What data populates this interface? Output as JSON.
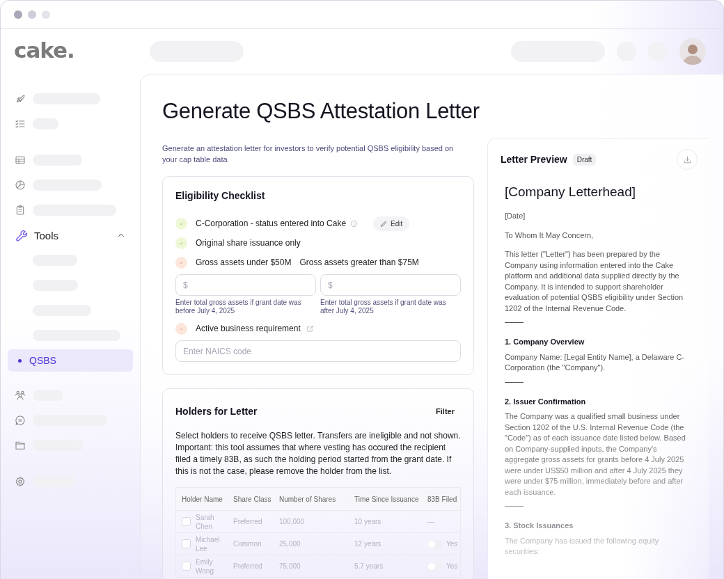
{
  "logo": "cake.",
  "sidebar": {
    "sections": [
      {
        "items": [
          {
            "kind": "skeleton"
          },
          {
            "kind": "skeleton"
          }
        ]
      },
      {
        "items": [
          {
            "kind": "skeleton"
          },
          {
            "kind": "skeleton"
          },
          {
            "kind": "skeleton"
          },
          {
            "kind": "group",
            "label": "Tools",
            "expanded": true,
            "children": [
              {
                "kind": "skeleton",
                "selected": false
              },
              {
                "kind": "skeleton",
                "selected": false
              },
              {
                "kind": "skeleton",
                "selected": false
              },
              {
                "kind": "skeleton",
                "selected": false
              },
              {
                "kind": "link",
                "label": "QSBS",
                "selected": true
              }
            ]
          }
        ]
      },
      {
        "items": [
          {
            "kind": "skeleton"
          },
          {
            "kind": "skeleton"
          },
          {
            "kind": "skeleton"
          }
        ]
      },
      {
        "items": [
          {
            "kind": "skeleton"
          }
        ]
      }
    ]
  },
  "page": {
    "title": "Generate QSBS Attestation Letter",
    "subtitle": "Generate an attestation letter for investors to verify potential QSBS eligibility based on your cap table data"
  },
  "eligibility": {
    "title": "Eligibility Checklist",
    "items": [
      {
        "kind": "edit",
        "met": true,
        "label": "C-Corporation - status entered into Cake",
        "action": "Edit"
      },
      {
        "kind": "plain",
        "met": true,
        "label": "Original share issuance only"
      },
      {
        "kind": "plain",
        "met": false,
        "label": "Gross assets under $50M",
        "label_2": "Gross assets greater than $75M",
        "fields": [
          {
            "placeholder": "$",
            "hint": "Enter total gross assets if grant date was before July 4, 2025"
          },
          {
            "placeholder": "$",
            "hint": "Enter total gross assets if grant date was after July 4, 2025"
          }
        ]
      },
      {
        "kind": "external",
        "met": false,
        "label": "Active business requirement",
        "fields": [
          {
            "placeholder": "Enter NAICS code"
          }
        ]
      }
    ]
  },
  "holders": {
    "title": "Holders for Letter",
    "filter": "Filter",
    "description": "Select holders to receive QSBS letter. Transfers are ineligible and not shown. Important: this tool assumes that where vesting has occured the recipient filed a timely 83B, as such the holding period started from the grant date. If this is not the case, please remove the holder from the list.",
    "columns": [
      "Holder Name",
      "Share Class",
      "Number of Shares",
      "Time Since Issuance",
      "83B Filed"
    ],
    "rows": [
      {
        "selected": false,
        "name": "Sarah Chen",
        "share_class": "Preferred",
        "shares": "100,000",
        "time": "10 years",
        "filed": {
          "kind": "dash",
          "text": "—"
        }
      },
      {
        "selected": false,
        "name": "Michael Lee",
        "share_class": "Common",
        "shares": "25,000",
        "time": "12 years",
        "filed": {
          "kind": "toggle",
          "on": false,
          "text": "Yes"
        }
      },
      {
        "selected": false,
        "name": "Emily Wong",
        "share_class": "Preferred",
        "shares": "75,000",
        "time": "5.7 years",
        "filed": {
          "kind": "toggle",
          "on": false,
          "text": "Yes"
        }
      }
    ]
  },
  "preview": {
    "title": "Letter Preview",
    "badge": "Draft",
    "blocks": [
      {
        "kind": "heading",
        "text": "[Company Letterhead]"
      },
      {
        "kind": "text",
        "text": "[Date]"
      },
      {
        "kind": "text",
        "text": "To Whom It May Concern,"
      },
      {
        "kind": "text",
        "text": "This letter (\"Letter\") has been prepared by the Company using information entered into the Cake platform and additional data supplied directly by the Company. It is intended to support shareholder evaluation of potential QSBS eligibility under Section 1202 of the Internal Revenue Code."
      },
      {
        "kind": "rule"
      },
      {
        "kind": "section",
        "text": "1. Company Overview"
      },
      {
        "kind": "text",
        "text": "Company Name: [Legal Entity Name], a Delaware C-Corporation (the \"Company\")."
      },
      {
        "kind": "rule"
      },
      {
        "kind": "section",
        "text": "2. Issuer Confirmation"
      },
      {
        "kind": "text",
        "text": "The Company was a qualified small business under Section 1202 of the U.S. Internal Revenue Code (the \"Code\") as of each issuance date listed below. Based on Company-supplied inputs, the Company's aggregate gross assets for grants before 4 July 2025 were under US$50 million and after 4 July 2025 they were under $75 million, immediately before and after each issuance."
      },
      {
        "kind": "rule"
      },
      {
        "kind": "section",
        "text": "3. Stock Issuances"
      },
      {
        "kind": "text",
        "text": "The Company has issued the following equity securities:"
      }
    ]
  }
}
